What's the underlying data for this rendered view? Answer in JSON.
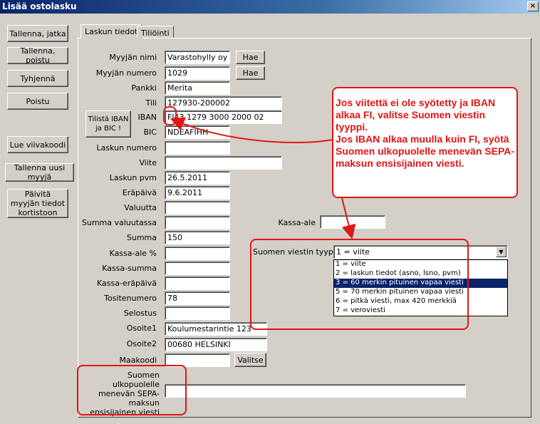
{
  "window": {
    "title": "Lisää ostolasku",
    "close_glyph": "×"
  },
  "left_buttons": {
    "save_continue": "Tallenna, jatka",
    "save_exit": "Tallenna, poistu",
    "clear": "Tyhjennä",
    "exit": "Poistu",
    "read_barcode": "Lue viivakoodi",
    "save_new_seller": "Tallenna uusi myyjä",
    "update_seller": "Päivitä myyjän tiedot kortistoon"
  },
  "tabs": [
    "Laskun tiedot",
    "Tiliöinti"
  ],
  "fields": {
    "seller_name": {
      "label": "Myyjän nimi",
      "value": "Varastohylly oy"
    },
    "seller_number": {
      "label": "Myyjän numero",
      "value": "1029"
    },
    "bank": {
      "label": "Pankki",
      "value": "Merita"
    },
    "account": {
      "label": "Tili",
      "value": "127930-200002"
    },
    "iban": {
      "label": "IBAN",
      "value": "FI43 1279 3000 2000 02"
    },
    "bic": {
      "label": "BIC",
      "value": "NDEAFIHH"
    },
    "invoice_number": {
      "label": "Laskun numero",
      "value": ""
    },
    "reference": {
      "label": "Viite",
      "value": ""
    },
    "invoice_date": {
      "label": "Laskun pvm",
      "value": "26.5.2011"
    },
    "due_date": {
      "label": "Eräpäivä",
      "value": "9.6.2011"
    },
    "currency": {
      "label": "Valuutta",
      "value": ""
    },
    "amount_currency": {
      "label": "Summa valuutassa",
      "value": ""
    },
    "amount": {
      "label": "Summa",
      "value": "150"
    },
    "discount_pct": {
      "label": "Kassa-ale %",
      "value": ""
    },
    "discount_amount": {
      "label": "Kassa-summa",
      "value": ""
    },
    "discount_due": {
      "label": "Kassa-eräpäivä",
      "value": ""
    },
    "voucher_number": {
      "label": "Tositenumero",
      "value": "78"
    },
    "description": {
      "label": "Selostus",
      "value": ""
    },
    "address1": {
      "label": "Osoite1",
      "value": "Koulumestarintie 123"
    },
    "address2": {
      "label": "Osoite2",
      "value": "00680  HELSINKI"
    },
    "country_code": {
      "label": "Maakoodi",
      "value": ""
    },
    "sepa_message": {
      "label": "Suomen ulkopuolelle menevän SEPA-maksun ensisijainen viesti",
      "value": ""
    },
    "kassa_ale": {
      "label": "Kassa-ale",
      "value": ""
    }
  },
  "buttons": {
    "search1": "Hae",
    "search2": "Hae",
    "print_iban": "Tilistä IBAN ja BIC !",
    "choose": "Valitse"
  },
  "message_type": {
    "label": "Suomen viestin tyyppi",
    "selected": "1 = viite",
    "options": [
      "1 = viite",
      "2 = laskun tiedot (asno, lsno, pvm)",
      "3 = 60 merkin pituinen vapaa viesti",
      "5 = 70 merkin pituinen vapaa viesti",
      "6 = pitkä viesti, max 420 merkkiä",
      "7 = veroviesti"
    ],
    "highlighted_index": 2
  },
  "note": {
    "line1": "Jos viitettä ei ole syötetty ja IBAN alkaa FI, valitse Suomen viestin tyyppi.",
    "line2": "Jos IBAN alkaa muulla kuin FI, syötä Suomen ulkopuolelle menevän SEPA-maksun ensisijainen viesti."
  },
  "colors": {
    "annotation": "#e01515",
    "title_bar": "#0a246a",
    "selection": "#0a246a"
  }
}
